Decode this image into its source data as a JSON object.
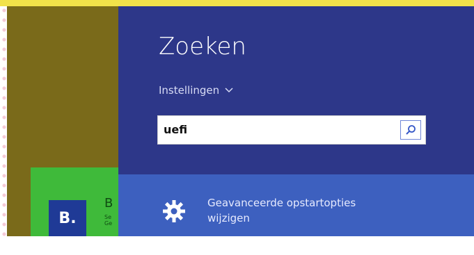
{
  "search_panel": {
    "title": "Zoeken",
    "scope_label": "Instellingen",
    "query": "uefi"
  },
  "result": {
    "line1": "Geavanceerde opstartopties",
    "line2": "wijzigen"
  },
  "start_tile": {
    "icon_letter": "B.",
    "text_big": "B",
    "text_small_1": "Se",
    "text_small_2": "Ge"
  },
  "colors": {
    "charm_bg": "#2d3789",
    "result_highlight": "#3d60bf",
    "tile_green": "#3fba3a",
    "olive_panel": "#7a6a1a",
    "top_strip": "#f2e24a"
  },
  "icons": {
    "scope": "chevron-down-icon",
    "search": "search-icon",
    "result": "gear-icon"
  }
}
